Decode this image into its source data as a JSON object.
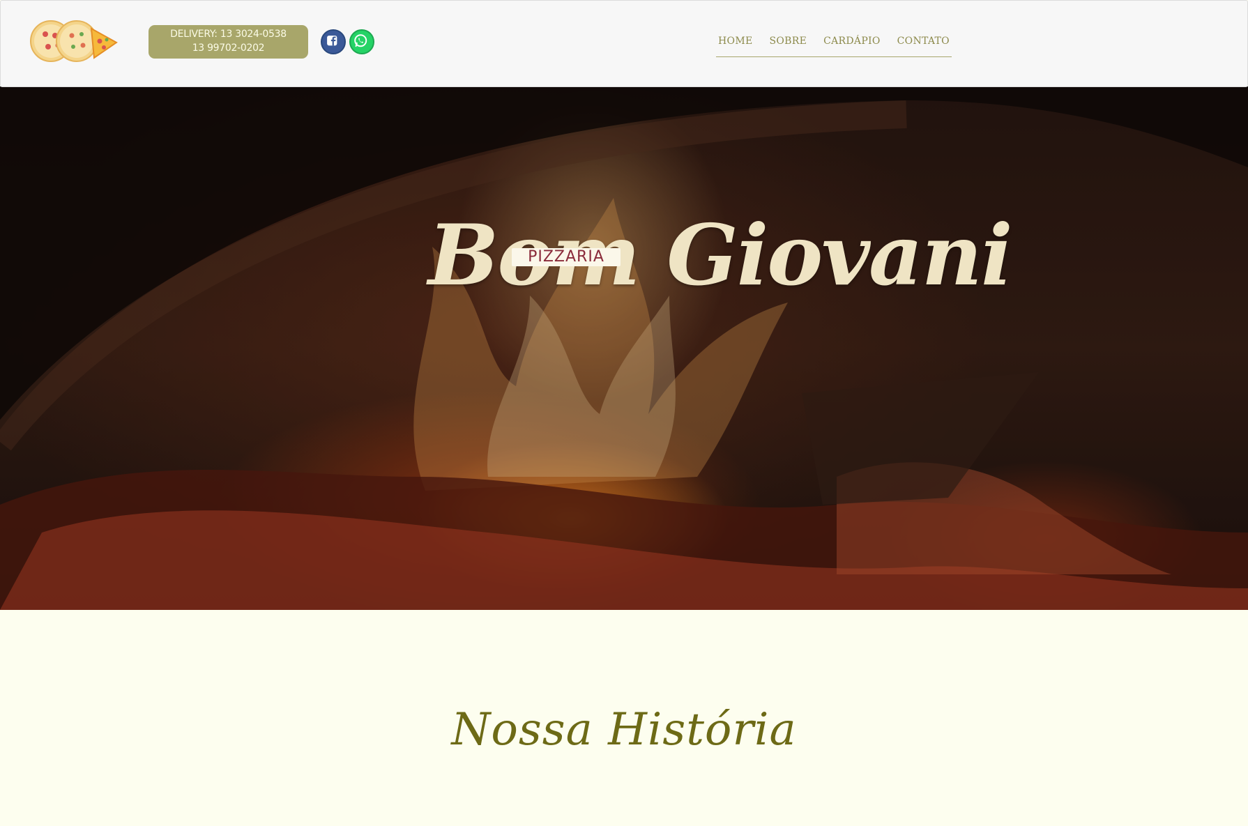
{
  "header": {
    "delivery_line1": "DELIVERY: 13 3024-0538",
    "delivery_line2": "13 99702-0202",
    "social": [
      {
        "icon": "facebook-icon",
        "color": "#3b5998"
      },
      {
        "icon": "whatsapp-icon",
        "color": "#25d366"
      }
    ],
    "nav": [
      "HOME",
      "SOBRE",
      "CARDÁPIO",
      "CONTATO"
    ]
  },
  "hero": {
    "tag": "PIZZARIA",
    "title": "Bom Giovani"
  },
  "section": {
    "title": "Nossa História"
  },
  "colors": {
    "accent": "#a8a66a",
    "nav_text": "#8c8a4b",
    "section_title": "#6d6a16",
    "background": "#fdfeef",
    "hero_title": "#efe4c4",
    "tag_text": "#8a2a3a"
  }
}
